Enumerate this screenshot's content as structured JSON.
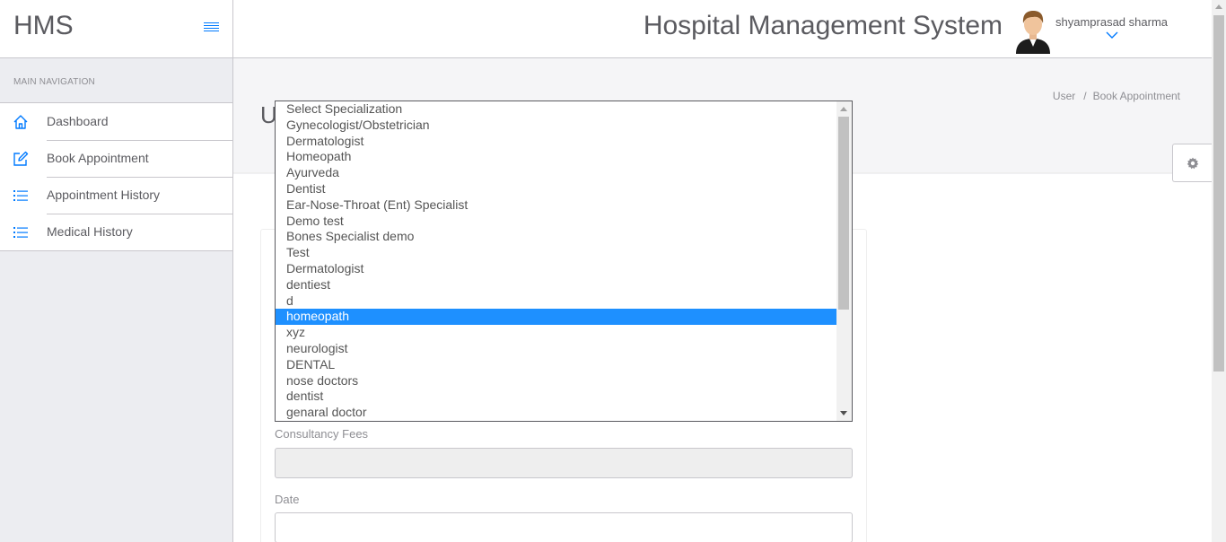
{
  "brand": {
    "name": "HMS"
  },
  "sidebar": {
    "heading": "MAIN NAVIGATION",
    "items": [
      {
        "label": "Dashboard",
        "icon": "home-icon"
      },
      {
        "label": "Book Appointment",
        "icon": "edit-icon"
      },
      {
        "label": "Appointment History",
        "icon": "list-icon"
      },
      {
        "label": "Medical History",
        "icon": "list-icon"
      }
    ]
  },
  "header": {
    "title": "Hospital Management System",
    "user_name": "shyamprasad sharma"
  },
  "page": {
    "title_fragment": "U",
    "breadcrumb": [
      "User",
      "Book Appointment"
    ]
  },
  "form": {
    "consultancy_fees_label": "Consultancy Fees",
    "consultancy_fees_value": "",
    "date_label": "Date",
    "date_value": ""
  },
  "specialization_dropdown": {
    "options": [
      "Select Specialization",
      "Gynecologist/Obstetrician",
      "Dermatologist",
      "Homeopath",
      "Ayurveda",
      "Dentist",
      "Ear-Nose-Throat (Ent) Specialist",
      "Demo test",
      "Bones Specialist demo",
      "Test",
      "Dermatologist",
      "dentiest",
      "d",
      "homeopath",
      "xyz",
      "neurologist",
      "DENTAL",
      "nose doctors",
      "dentist",
      "genaral doctor"
    ],
    "highlighted": "homeopath"
  },
  "colors": {
    "accent": "#007aff",
    "highlight": "#1e90ff",
    "text": "#5b5b60"
  }
}
